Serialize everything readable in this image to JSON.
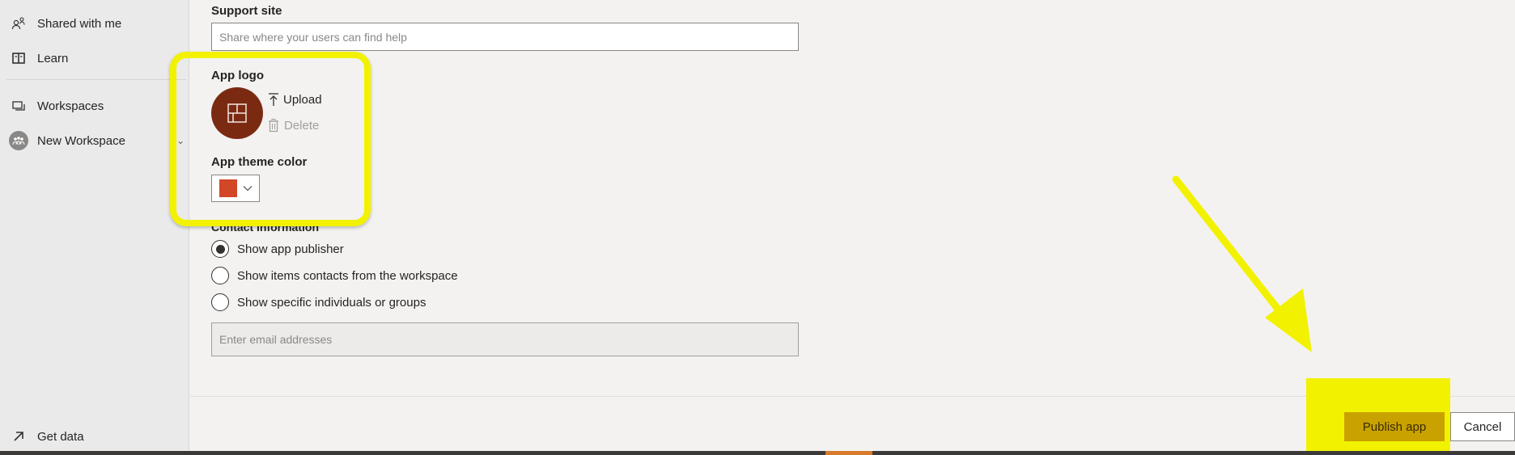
{
  "sidebar": {
    "items": [
      {
        "label": "Shared with me",
        "icon": "shared-people-icon"
      },
      {
        "label": "Learn",
        "icon": "book-icon"
      },
      {
        "label": "Workspaces",
        "icon": "workspaces-icon"
      },
      {
        "label": "New Workspace",
        "icon": "workspace-avatar-icon"
      },
      {
        "label": "Get data",
        "icon": "arrow-up-right-icon"
      }
    ]
  },
  "form": {
    "support_site": {
      "label": "Support site",
      "placeholder": "Share where your users can find help",
      "value": ""
    },
    "app_logo": {
      "label": "App logo",
      "upload_label": "Upload",
      "delete_label": "Delete",
      "logo_color": "#7b2a12"
    },
    "app_theme_color": {
      "label": "App theme color",
      "swatch_color": "#d24726"
    },
    "contact_information": {
      "label": "Contact Information",
      "options": [
        {
          "label": "Show app publisher",
          "selected": true
        },
        {
          "label": "Show items contacts from the workspace",
          "selected": false
        },
        {
          "label": "Show specific individuals or groups",
          "selected": false
        }
      ],
      "email_placeholder": "Enter email addresses"
    }
  },
  "footer": {
    "publish_label": "Publish app",
    "cancel_label": "Cancel"
  },
  "annotations": {
    "highlight_color": "#f2f200"
  }
}
